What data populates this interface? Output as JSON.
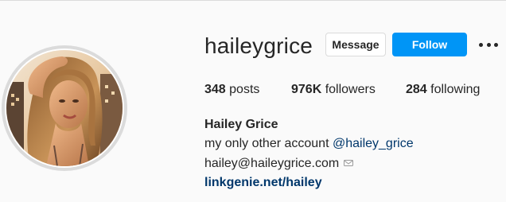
{
  "profile": {
    "username": "haileygrice",
    "full_name": "Hailey Grice",
    "buttons": {
      "message": "Message",
      "follow": "Follow"
    },
    "stats": {
      "posts_count": "348",
      "posts_label": "posts",
      "followers_count": "976K",
      "followers_label": "followers",
      "following_count": "284",
      "following_label": "following"
    },
    "bio": {
      "text": "my only other account ",
      "mention": "@hailey_grice",
      "email": "hailey@haileygrice.com",
      "link": "linkgenie.net/hailey"
    }
  },
  "icons": {
    "more": "more-options-icon",
    "email_decoration": "envelope-icon"
  },
  "colors": {
    "background": "#fafafa",
    "follow_button": "#0095f6",
    "link": "#00376b",
    "text": "#262626"
  }
}
